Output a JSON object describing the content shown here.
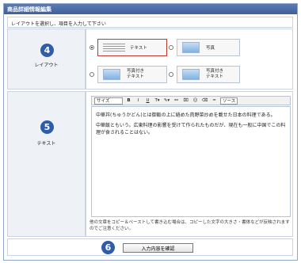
{
  "panel": {
    "title": "商品詳細情報編集"
  },
  "instruction": "レイアウトを選択し、項目を入力して下さい",
  "layout_section": {
    "number": "4",
    "label": "レイアウト",
    "options": [
      {
        "label": "テキスト",
        "selected": true,
        "type": "text"
      },
      {
        "label": "写真",
        "selected": false,
        "type": "photo"
      },
      {
        "label": "写真付き\nテキスト",
        "selected": false,
        "type": "photo-text"
      },
      {
        "label": "写真付き\nテキスト",
        "selected": false,
        "type": "text-photo"
      }
    ]
  },
  "text_section": {
    "number": "5",
    "label": "テキスト",
    "toolbar": {
      "size_label": "サイズ",
      "bold": "B",
      "italic": "I",
      "underline": "U",
      "source_label": "ソース"
    },
    "editor_paragraphs": [
      "中華丼(ちゅうかどん)とは御飯の上に絡めた肉野菜炒めを載せた日本の料理である。",
      "中華飯ともいう。広東料理の影響を受けて作られたものだが、現在も一般に中国でこの料理が食されることはない。"
    ],
    "note": "他の文章をコピー＆ペーストして書き込む場合は、コピーした文字の大きさ・書体などが反映されますのでご注意ください。"
  },
  "footer": {
    "number": "6",
    "confirm_label": "入力内容を確認"
  }
}
